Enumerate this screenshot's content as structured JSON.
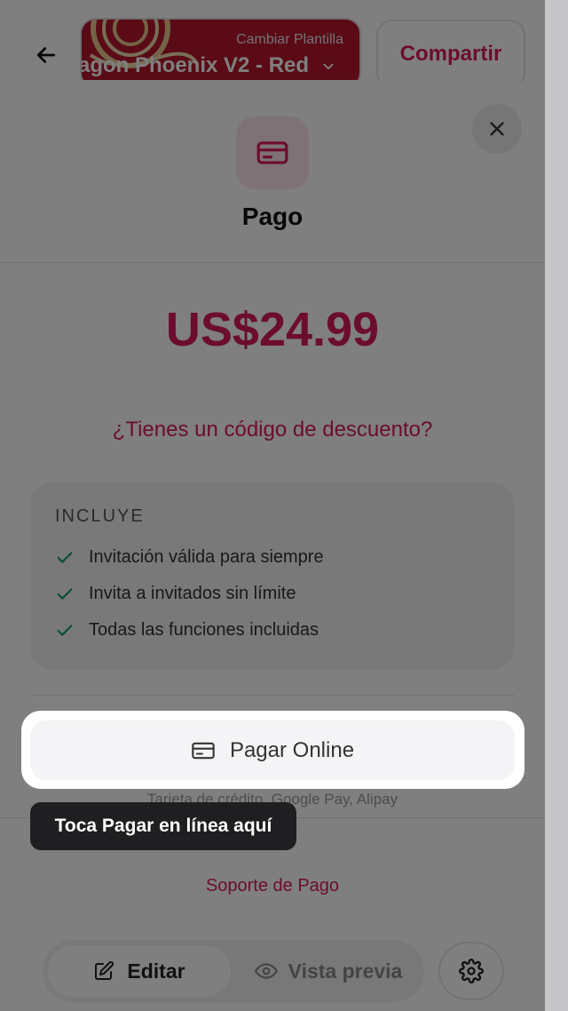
{
  "topbar": {
    "template_caption": "Cambiar Plantilla",
    "template_name": "agon Phoenix V2 - Red",
    "share_label": "Compartir"
  },
  "bottombar": {
    "edit_label": "Editar",
    "preview_label": "Vista previa"
  },
  "modal": {
    "title": "Pago",
    "price": "US$24.99",
    "discount_link": "¿Tienes un código de descuento?",
    "includes_title": "INCLUYE",
    "features": [
      "Invitación válida para siempre",
      "Invita a invitados sin límite",
      "Todas las funciones incluidas"
    ],
    "pay_button": "Pagar Online",
    "payment_methods": "Tarjeta de crédito, Google Pay, Alipay",
    "support_link": "Soporte de Pago"
  },
  "tooltip": "Toca Pagar en línea aquí",
  "colors": {
    "accent": "#d81b60",
    "check": "#1a9e6e",
    "tooltip_bg": "#1f1f21"
  },
  "icons": [
    "arrow-left-icon",
    "chevron-down-icon",
    "credit-card-icon",
    "close-icon",
    "check-icon",
    "pencil-icon",
    "eye-icon",
    "gear-icon"
  ]
}
